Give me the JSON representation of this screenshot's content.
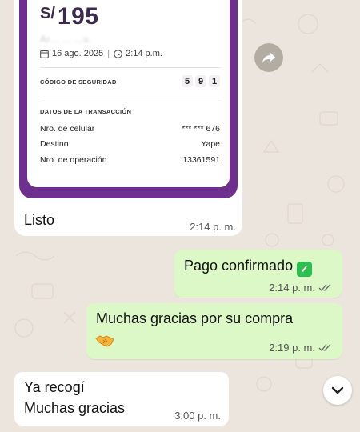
{
  "receipt": {
    "currency": "S/",
    "amount": "195",
    "recipient_blurred": "Ar... ... ...v.",
    "date": "16 ago. 2025",
    "time": "2:14 p.m.",
    "security_label": "CÓDIGO DE SEGURIDAD",
    "security_code": [
      "5",
      "9",
      "1"
    ],
    "transaction_label": "DATOS DE LA TRANSACCIÓN",
    "rows": [
      {
        "label": "Nro. de celular",
        "value": "*** *** 676"
      },
      {
        "label": "Destino",
        "value": "Yape"
      },
      {
        "label": "Nro. de operación",
        "value": "13361591"
      }
    ]
  },
  "messages": {
    "receipt_caption": "Listo",
    "receipt_caption_time": "2:14 p. m.",
    "out1_text": "Pago confirmado",
    "out1_time": "2:14 p. m.",
    "out2_text": "Muchas gracias por su compra",
    "out2_time": "2:19 p. m.",
    "in_line1": "Ya recogí",
    "in_line2": "Muchas gracias",
    "in_time": "3:00 p. m."
  },
  "icons": {
    "forward": "forward-icon",
    "check": "check-emoji-icon",
    "handshake": "handshake-emoji-icon",
    "read_receipt": "double-check-icon",
    "scroll_down": "chevron-down-icon"
  },
  "colors": {
    "chat_bg": "#ece5dd",
    "outgoing_bubble": "#dcf8c6",
    "incoming_bubble": "#ffffff",
    "yape_purple": "#6e2f8f"
  }
}
